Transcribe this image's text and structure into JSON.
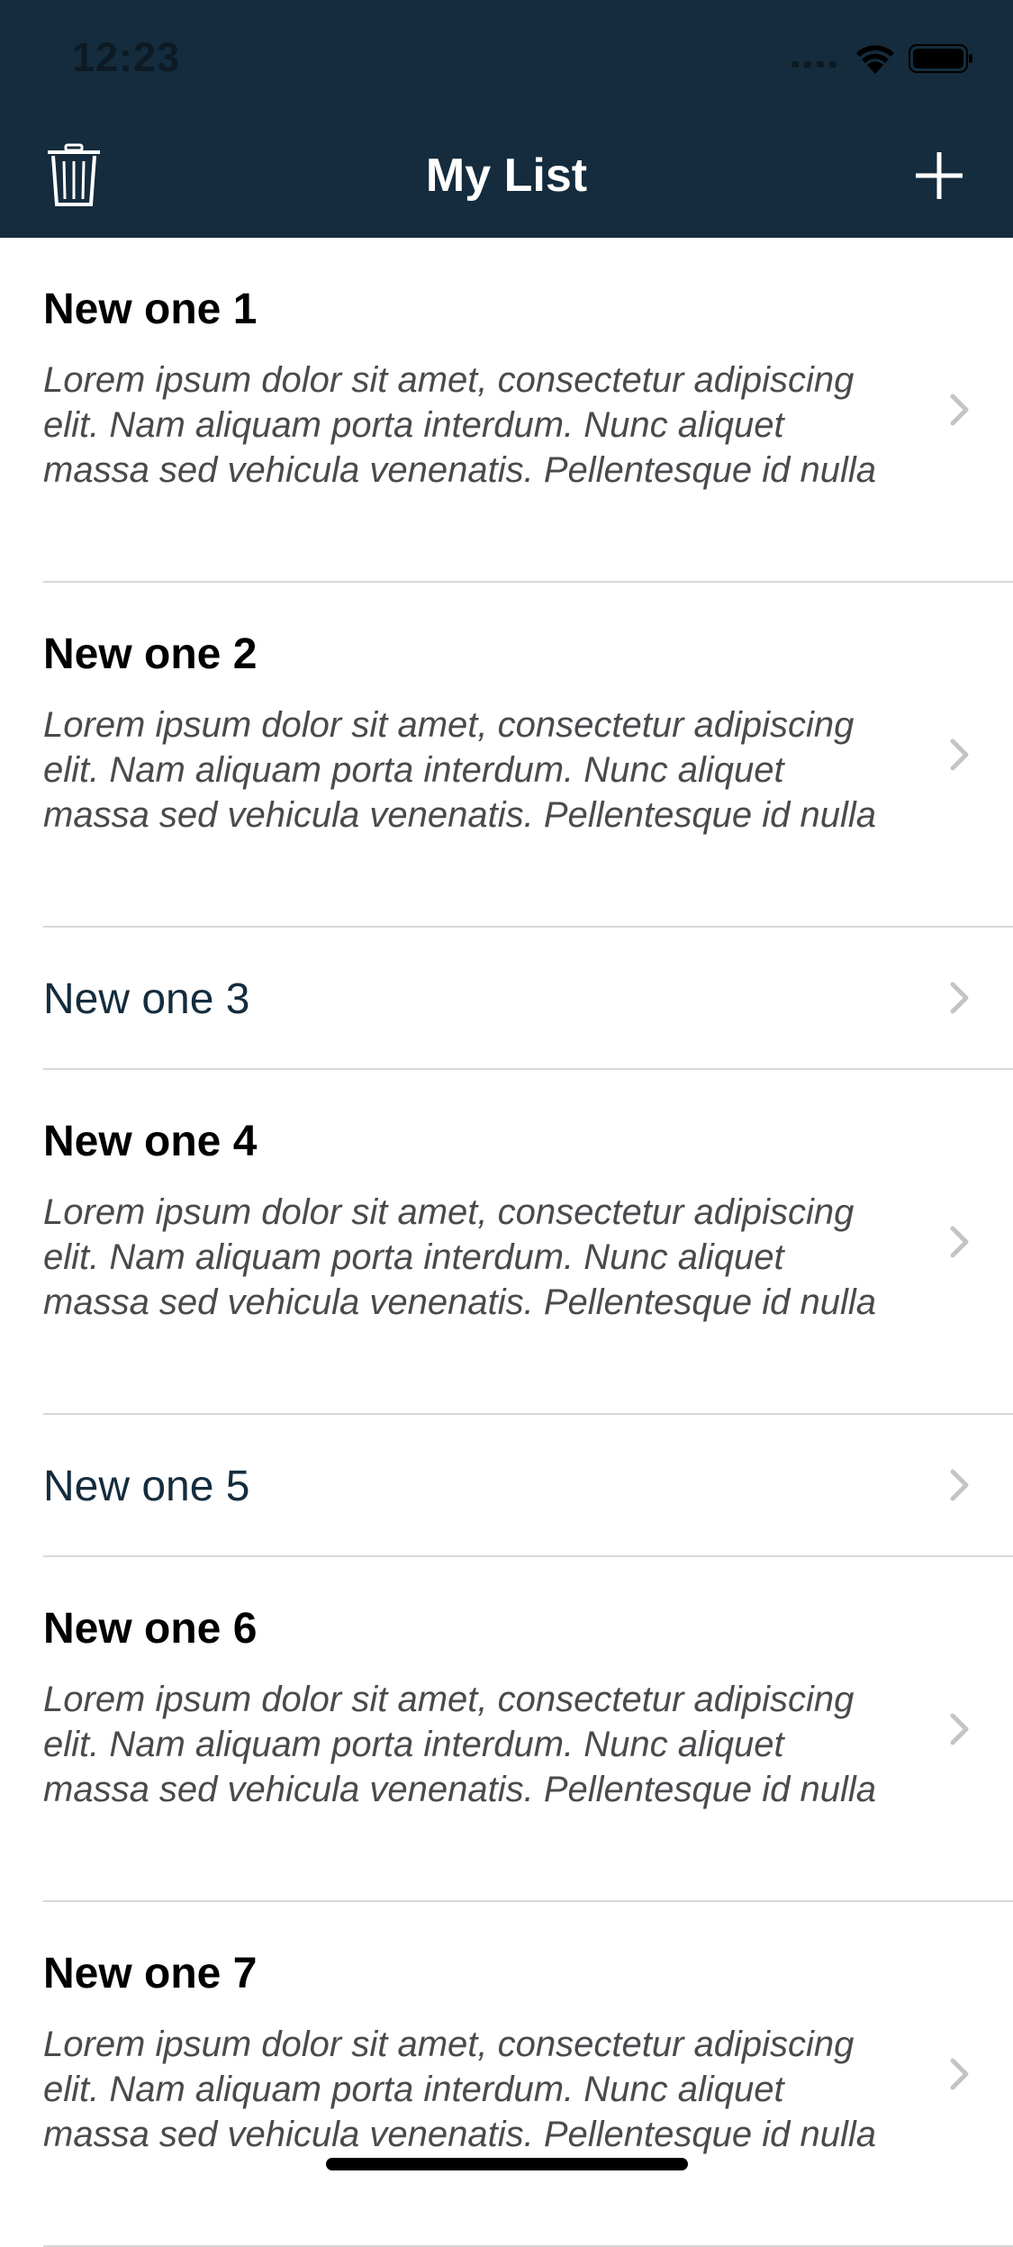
{
  "status_bar": {
    "time": "12:23"
  },
  "nav": {
    "title": "My List",
    "left_icon": "trash-icon",
    "right_icon": "plus-icon"
  },
  "items": [
    {
      "title": "New one 1",
      "description": "Lorem ipsum dolor sit amet, consectetur adipiscing elit. Nam aliquam porta interdum. Nunc aliquet massa sed vehicula venenatis. Pellentesque id nulla"
    },
    {
      "title": "New one 2",
      "description": "Lorem ipsum dolor sit amet, consectetur adipiscing elit. Nam aliquam porta interdum. Nunc aliquet massa sed vehicula venenatis. Pellentesque id nulla"
    },
    {
      "title": "New one 3"
    },
    {
      "title": "New one 4",
      "description": "Lorem ipsum dolor sit amet, consectetur adipiscing elit. Nam aliquam porta interdum. Nunc aliquet massa sed vehicula venenatis. Pellentesque id nulla"
    },
    {
      "title": "New one 5"
    },
    {
      "title": "New one 6",
      "description": "Lorem ipsum dolor sit amet, consectetur adipiscing elit. Nam aliquam porta interdum. Nunc aliquet massa sed vehicula venenatis. Pellentesque id nulla"
    },
    {
      "title": "New one 7",
      "description": "Lorem ipsum dolor sit amet, consectetur adipiscing elit. Nam aliquam porta interdum. Nunc aliquet massa sed vehicula venenatis. Pellentesque id nulla"
    }
  ],
  "colors": {
    "nav_background": "#142c3d",
    "compact_title": "#142c3d",
    "separator": "#d8d8dc",
    "chevron": "#c4c4c8"
  }
}
